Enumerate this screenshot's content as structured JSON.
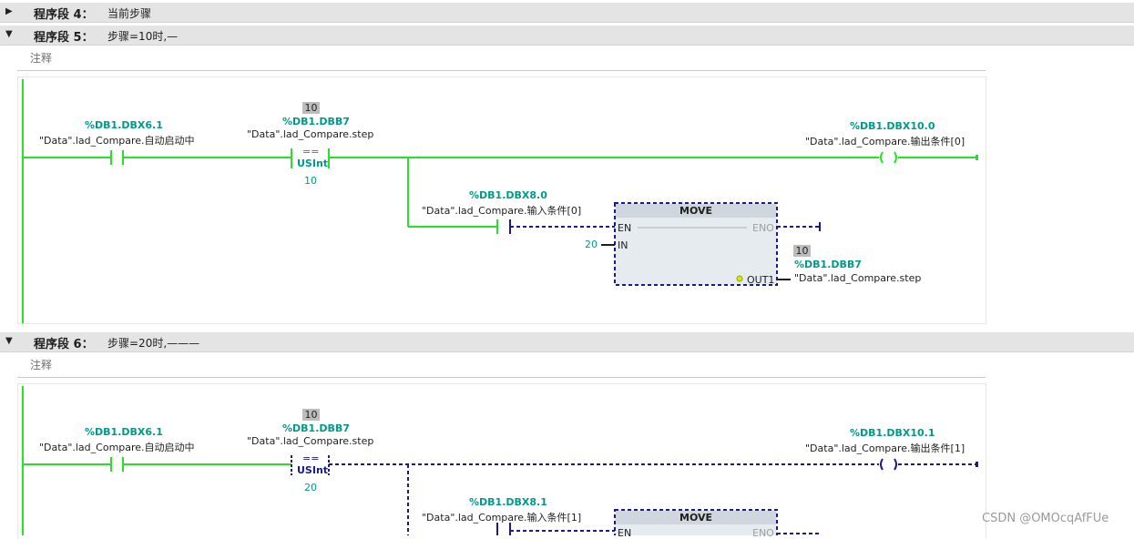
{
  "segments": [
    {
      "title": "程序段 4：",
      "desc": "当前步骤",
      "expanded": false
    },
    {
      "title": "程序段 5：",
      "desc": "步骤=10时,—",
      "expanded": true,
      "comment": "注释"
    },
    {
      "title": "程序段 6：",
      "desc": "步骤=20时,———",
      "expanded": true,
      "comment": "注释"
    }
  ],
  "network5": {
    "contact": {
      "address": "%DB1.DBX6.1",
      "tag": "\"Data\".lad_Compare.自动启动中"
    },
    "compare": {
      "actual": "10",
      "address": "%DB1.DBB7",
      "tag": "\"Data\".lad_Compare.step",
      "op": "==",
      "type": "USInt",
      "value": "10"
    },
    "coil": {
      "address": "%DB1.DBX10.0",
      "tag": "\"Data\".lad_Compare.输出条件[0]"
    },
    "contact2": {
      "address": "%DB1.DBX8.0",
      "tag": "\"Data\".lad_Compare.输入条件[0]"
    },
    "move": {
      "title": "MOVE",
      "en": "EN",
      "eno": "ENO",
      "in_label": "IN",
      "in_value": "20",
      "out_label": "OUT1",
      "out_actual": "10",
      "out_address": "%DB1.DBB7",
      "out_tag": "\"Data\".lad_Compare.step"
    }
  },
  "network6": {
    "contact": {
      "address": "%DB1.DBX6.1",
      "tag": "\"Data\".lad_Compare.自动启动中"
    },
    "compare": {
      "actual": "10",
      "address": "%DB1.DBB7",
      "tag": "\"Data\".lad_Compare.step",
      "op": "==",
      "type": "USInt",
      "value": "20"
    },
    "coil": {
      "address": "%DB1.DBX10.1",
      "tag": "\"Data\".lad_Compare.输出条件[1]"
    },
    "contact2": {
      "address": "%DB1.DBX8.1",
      "tag": "\"Data\".lad_Compare.输入条件[1]"
    },
    "move": {
      "title": "MOVE",
      "en": "EN",
      "eno": "ENO"
    }
  },
  "watermark": "CSDN @OMOcqAfFUe",
  "colors": {
    "energized": "#2adf2a",
    "de_energized": "#1a1a8c",
    "address": "#009a8a",
    "header_bg": "#e4e4e4"
  }
}
